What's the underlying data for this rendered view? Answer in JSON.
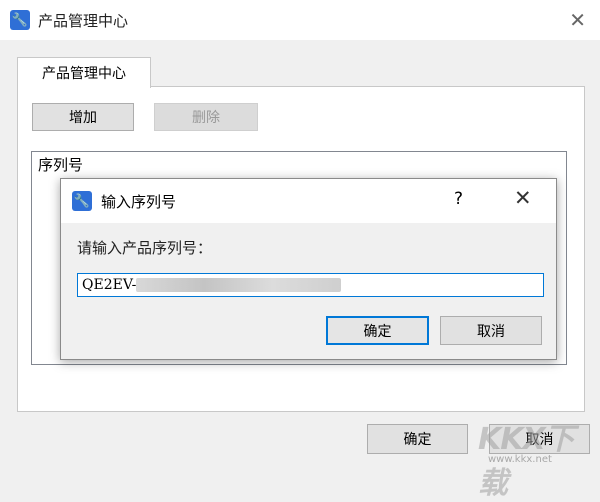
{
  "window": {
    "title": "产品管理中心",
    "app_icon": "wrench-icon",
    "close_icon": "close-icon"
  },
  "tab": {
    "label": "产品管理中心"
  },
  "toolbar": {
    "add_label": "增加",
    "delete_label": "删除"
  },
  "list": {
    "header": "序列号"
  },
  "footer": {
    "ok_label": "确定",
    "cancel_label": "取消"
  },
  "dialog": {
    "title": "输入序列号",
    "help_symbol": "?",
    "close_symbol": "✕",
    "prompt": "请输入产品序列号：",
    "serial_visible": "QE2EV-",
    "ok_label": "确定",
    "cancel_label": "取消"
  },
  "watermark": {
    "text": "KKX下载",
    "url": "www.kkx.net"
  },
  "colors": {
    "accent": "#0078d7",
    "icon_blue": "#2f6fd6"
  }
}
